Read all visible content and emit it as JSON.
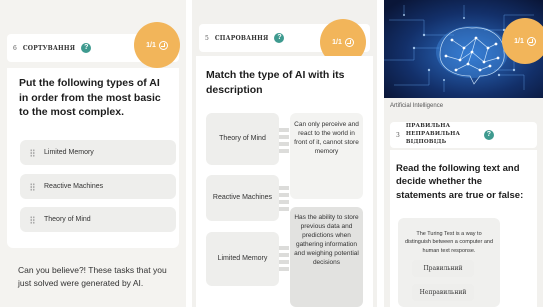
{
  "panel1": {
    "step": {
      "number": "6",
      "label": "СОРТУВАННЯ"
    },
    "badge": "1/1",
    "question": "Put the following types of AI in order from the most basic to the most complex.",
    "items": [
      {
        "label": "Limited Memory"
      },
      {
        "label": "Reactive Machines"
      },
      {
        "label": "Theory of Mind"
      }
    ],
    "footer": "Can you believe?! These tasks that you just solved were generated by AI."
  },
  "panel2": {
    "step": {
      "number": "5",
      "label": "СПАРОВАННЯ"
    },
    "badge": "1/1",
    "question": "Match the type of AI with its description",
    "pairs": [
      {
        "left": "Theory of Mind",
        "right": "Can only perceive and react to the world in front of it, cannot store memory"
      },
      {
        "left": "Reactive Machines",
        "right": ""
      },
      {
        "left": "Limited Memory",
        "right": "Has the ability to store previous data and predictions when gathering information and weighing potential decisions"
      }
    ]
  },
  "panel3": {
    "badge": "1/1",
    "hero_caption": "Artificial Intelligence",
    "step": {
      "number": "3",
      "label": "ПРАВИЛЬНА НЕПРАВИЛЬНА ВІДПОВІДЬ"
    },
    "question": "Read the following text and decide whether the statements are true or false:",
    "statement": "The Turing Test is a way to distinguish between a computer and human text response.",
    "options": [
      "Правильний",
      "Неправильний"
    ]
  },
  "colors": {
    "accent_badge": "#f2b55a",
    "help_icon": "#3e9a8f",
    "highlight_card": "#e2e2e0"
  }
}
